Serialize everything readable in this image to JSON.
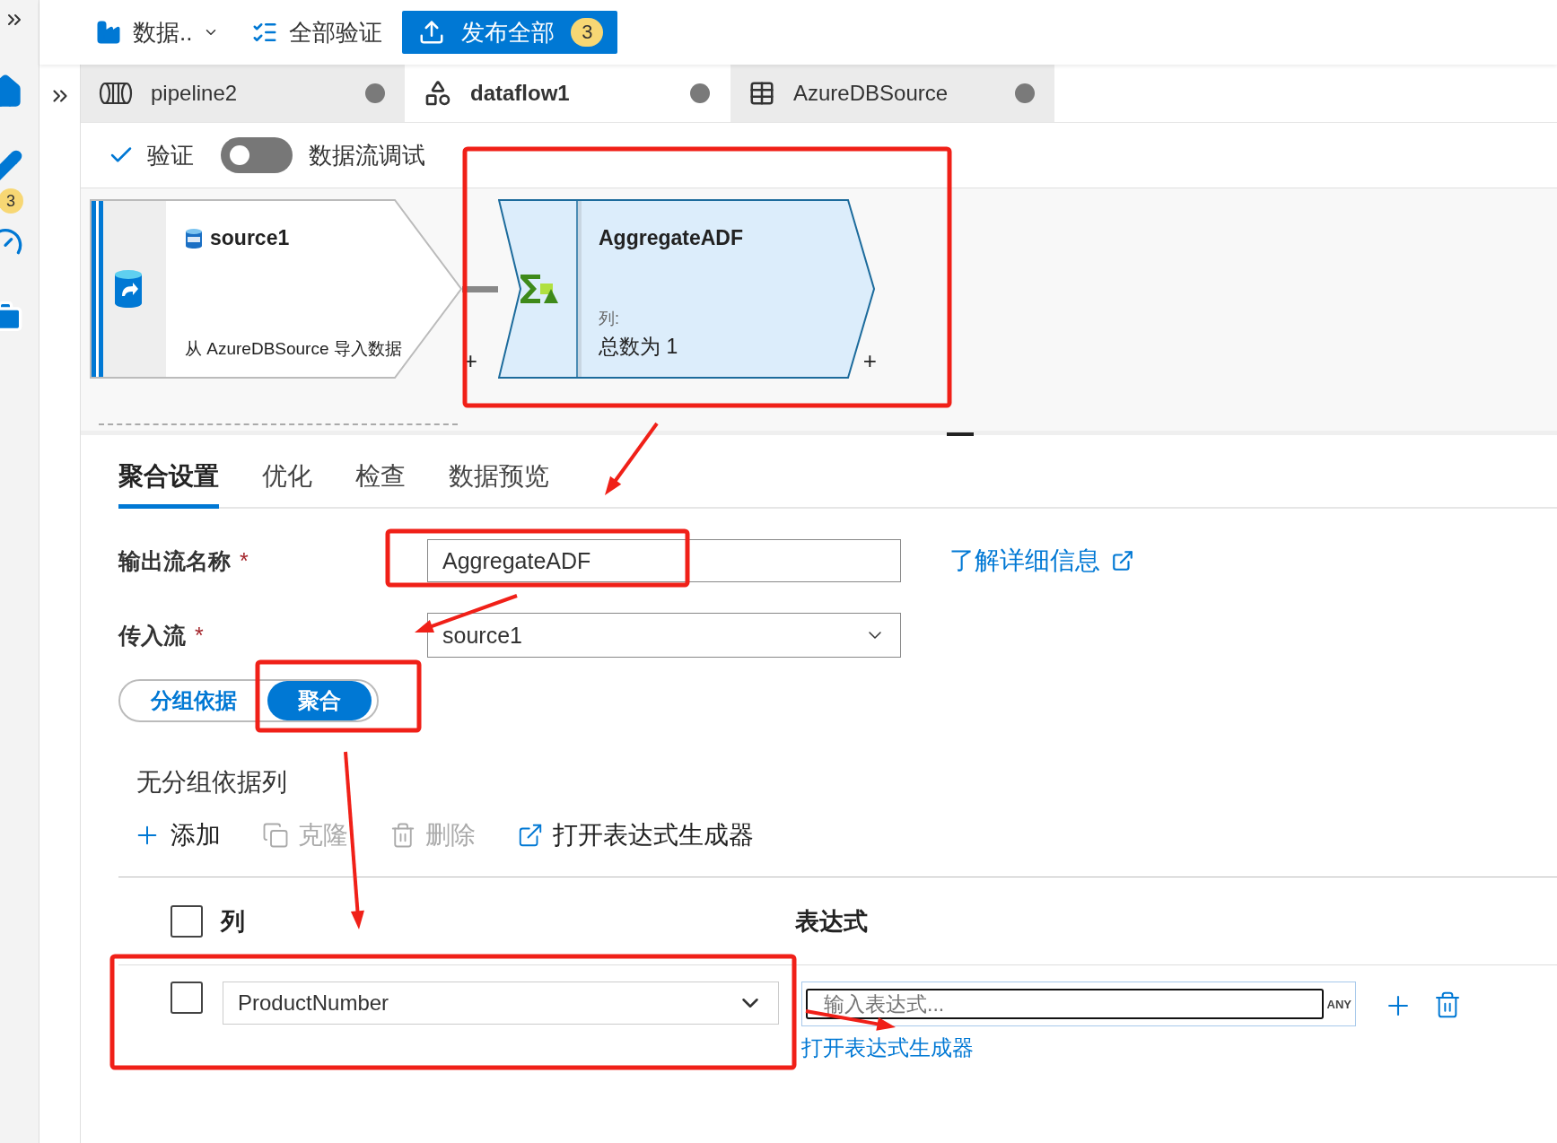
{
  "rail": {
    "badge": "3"
  },
  "toolbar": {
    "data_menu": "数据..",
    "validate_all": "全部验证",
    "publish": {
      "label": "发布全部",
      "count": "3"
    }
  },
  "tabs": [
    {
      "label": "pipeline2",
      "kind": "pipeline",
      "selected": false,
      "unsaved": true
    },
    {
      "label": "dataflow1",
      "kind": "dataflow",
      "selected": true,
      "unsaved": true
    },
    {
      "label": "AzureDBSource",
      "kind": "dataset",
      "selected": false,
      "unsaved": true
    }
  ],
  "actions": {
    "validate": "验证",
    "debug": {
      "label": "数据流调试",
      "on": false
    }
  },
  "nodes": [
    {
      "kind": "source",
      "title": "source1",
      "description": "从 AzureDBSource 导入数据",
      "plus": "+",
      "selected": false
    },
    {
      "kind": "aggregate",
      "title": "AggregateADF",
      "caption": "列:",
      "description": "总数为 1",
      "plus": "+",
      "selected": true
    }
  ],
  "panel_tabs": [
    {
      "label": "聚合设置",
      "selected": true
    },
    {
      "label": "优化",
      "selected": false
    },
    {
      "label": "检查",
      "selected": false
    },
    {
      "label": "数据预览",
      "selected": false
    }
  ],
  "form": {
    "output_name": {
      "label": "输出流名称",
      "required_mark": "*",
      "value": "AggregateADF"
    },
    "learn_more": "了解详细信息",
    "incoming": {
      "label": "传入流",
      "required_mark": "*",
      "value": "source1"
    }
  },
  "segments": [
    {
      "label": "分组依据",
      "selected": false
    },
    {
      "label": "聚合",
      "selected": true
    }
  ],
  "group_by_note": "无分组依据列",
  "commands": [
    {
      "kind": "add",
      "label": "添加",
      "disabled": false
    },
    {
      "kind": "clone",
      "label": "克隆",
      "disabled": true
    },
    {
      "kind": "delete",
      "label": "删除",
      "disabled": true
    },
    {
      "kind": "builder",
      "label": "打开表达式生成器",
      "disabled": false
    }
  ],
  "table": {
    "columns": [
      "列",
      "表达式"
    ],
    "header_checked": false,
    "rows": [
      {
        "checked": false,
        "column": "ProductNumber",
        "placeholder": "输入表达式...",
        "type": "ANY",
        "link": "打开表达式生成器"
      }
    ]
  }
}
